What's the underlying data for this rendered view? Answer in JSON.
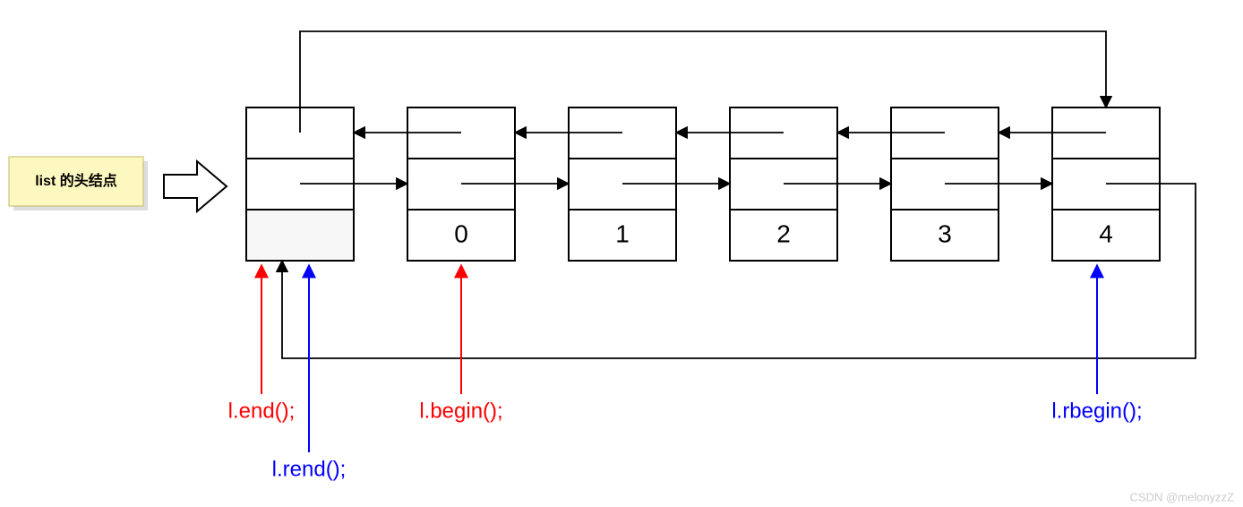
{
  "sticky": {
    "label": "list 的头结点"
  },
  "nodes": {
    "head": "",
    "values": [
      "0",
      "1",
      "2",
      "3",
      "4"
    ]
  },
  "pointers": {
    "end": "l.end();",
    "begin": "l.begin();",
    "rend": "l.rend();",
    "rbegin": "l.rbegin();"
  },
  "watermark": "CSDN @melonyzzZ"
}
